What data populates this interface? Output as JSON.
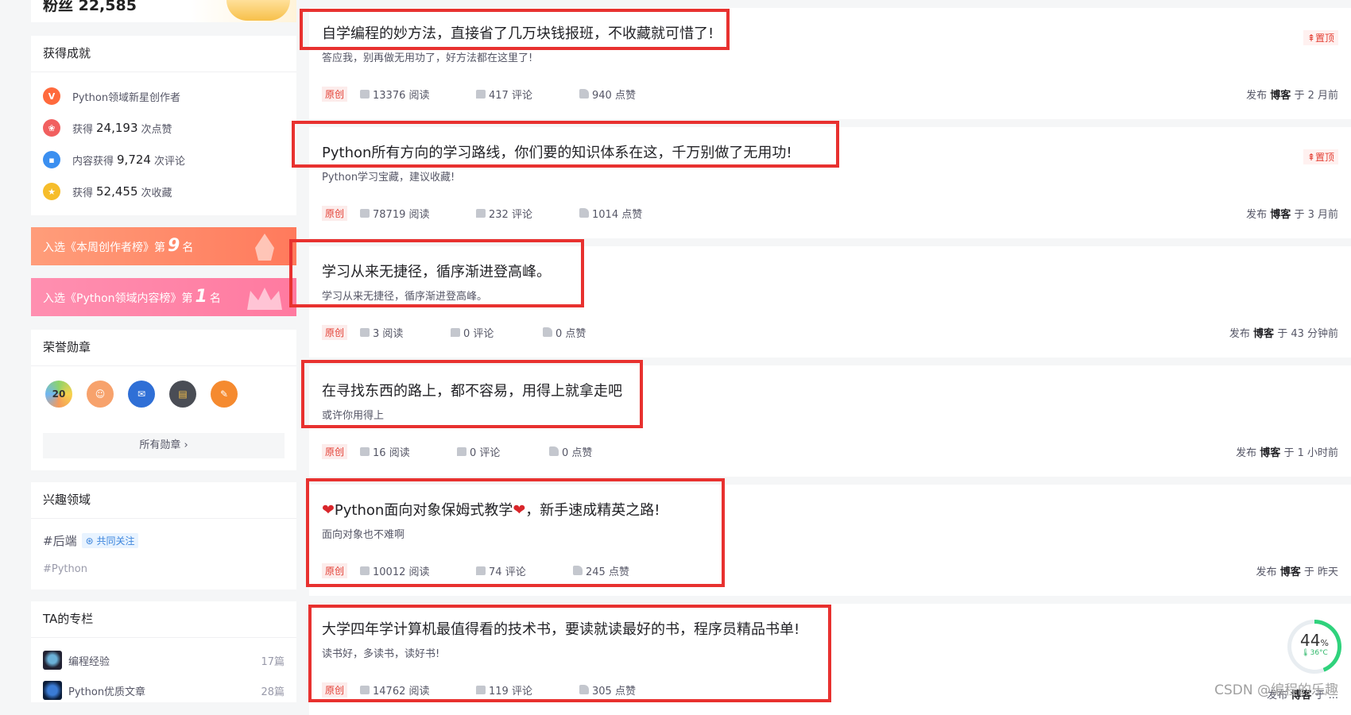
{
  "sidebar": {
    "top_stub_text": "粉丝 22,585",
    "achievements": {
      "title": "获得成就",
      "items": [
        {
          "prefix": "Python领域新星创作者",
          "value": "",
          "suffix": "",
          "icon": "v-badge-icon",
          "color": "#ff6a3d"
        },
        {
          "prefix": "获得",
          "value": "24,193",
          "suffix": "次点赞",
          "icon": "like-badge-icon",
          "color": "#f15f5f"
        },
        {
          "prefix": "内容获得",
          "value": "9,724",
          "suffix": "次评论",
          "icon": "comment-badge-icon",
          "color": "#3b8ff0"
        },
        {
          "prefix": "获得",
          "value": "52,455",
          "suffix": "次收藏",
          "icon": "star-badge-icon",
          "color": "#f6bd2b"
        }
      ]
    },
    "ranks": [
      {
        "prefix": "入选《本周创作者榜》第",
        "num": "9",
        "suffix": "名"
      },
      {
        "prefix": "入选《Python领域内容榜》第",
        "num": "1",
        "suffix": "名"
      }
    ],
    "medals": {
      "title": "荣誉勋章",
      "icons": [
        "20",
        "",
        "",
        "",
        ""
      ],
      "all_label": "所有勋章 ›"
    },
    "interests": {
      "title": "兴趣领域",
      "tag1": "#后端",
      "co_follow": "共同关注",
      "tag2": "#Python"
    },
    "columns": {
      "title": "TA的专栏",
      "items": [
        {
          "name": "编程经验",
          "count": "17篇"
        },
        {
          "name": "Python优质文章",
          "count": "28篇"
        }
      ]
    }
  },
  "articles": [
    {
      "title": "自学编程的妙方法，直接省了几万块钱报班，不收藏就可惜了!",
      "desc": "答应我，别再做无用功了，好方法都在这里了!",
      "orig": "原创",
      "reads": "13376 阅读",
      "comments": "417 评论",
      "likes": "940 点赞",
      "time_pre": "发布",
      "time_author": "博客",
      "time_post": "于 2 月前",
      "pinned": "置顶"
    },
    {
      "title": "Python所有方向的学习路线，你们要的知识体系在这，千万别做了无用功!",
      "desc": "Python学习宝藏，建议收藏!",
      "orig": "原创",
      "reads": "78719 阅读",
      "comments": "232 评论",
      "likes": "1014 点赞",
      "time_pre": "发布",
      "time_author": "博客",
      "time_post": "于 3 月前",
      "pinned": "置顶"
    },
    {
      "title": "学习从来无捷径，循序渐进登高峰。",
      "desc": "学习从来无捷径，循序渐进登高峰。",
      "orig": "原创",
      "reads": "3 阅读",
      "comments": "0 评论",
      "likes": "0 点赞",
      "time_pre": "发布",
      "time_author": "博客",
      "time_post": "于 43 分钟前",
      "pinned": ""
    },
    {
      "title": "在寻找东西的路上，都不容易，用得上就拿走吧",
      "desc": "或许你用得上",
      "orig": "原创",
      "reads": "16 阅读",
      "comments": "0 评论",
      "likes": "0 点赞",
      "time_pre": "发布",
      "time_author": "博客",
      "time_post": "于 1 小时前",
      "pinned": ""
    },
    {
      "title": "Python面向对象保姆式教学",
      "title_post": "，新手速成精英之路!",
      "desc": "面向对象也不难啊",
      "orig": "原创",
      "reads": "10012 阅读",
      "comments": "74 评论",
      "likes": "245 点赞",
      "time_pre": "发布",
      "time_author": "博客",
      "time_post": "于 昨天",
      "pinned": ""
    },
    {
      "title": "大学四年学计算机最值得看的技术书，要读就读最好的书，程序员精品书单!",
      "desc": "读书好，多读书，读好书!",
      "orig": "原创",
      "reads": "14762 阅读",
      "comments": "119 评论",
      "likes": "305 点赞",
      "time_pre": "发布",
      "time_author": "博客",
      "time_post": "于 ...",
      "pinned": ""
    }
  ],
  "widget": {
    "percent": "44",
    "percent_sign": "%",
    "temp": "36°C",
    "percent_value": 44
  },
  "watermark": "CSDN @编程的乐趣"
}
